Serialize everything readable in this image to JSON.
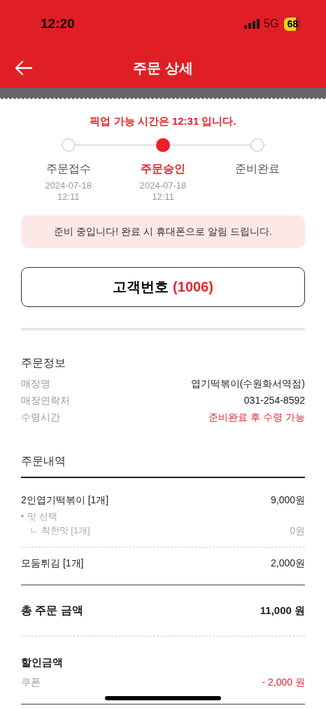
{
  "status_bar": {
    "time": "12:20",
    "network": "5G",
    "battery": "68"
  },
  "header": {
    "title": "주문 상세"
  },
  "pickup_notice": "픽업 가능 시간은 12:31 입니다.",
  "steps": [
    {
      "label": "주문접수",
      "date": "2024-07-18",
      "time": "12:11",
      "selected": false
    },
    {
      "label": "주문승인",
      "date": "2024-07-18",
      "time": "12:11",
      "selected": true
    },
    {
      "label": "준비완료",
      "selected": false
    }
  ],
  "alert": "준비 중입니다! 완료 시 휴대폰으로 알림 드립니다.",
  "customer_number": {
    "label": "고객번호",
    "value": "(1006)"
  },
  "order_info": {
    "title": "주문정보",
    "rows": [
      {
        "label": "매장명",
        "value": "엽기떡볶이(수원화서역점)",
        "emphasis": false
      },
      {
        "label": "매장연락처",
        "value": "031-254-8592",
        "emphasis": false
      },
      {
        "label": "수령시간",
        "value": "준비완료 후 수령 가능",
        "emphasis": true
      }
    ]
  },
  "order_items": {
    "title": "주문내역",
    "items": [
      {
        "name": "2인엽기떡볶이 [1개]",
        "price": "9,000원",
        "options": [
          {
            "label": "맛 선택",
            "choices": [
              {
                "label": "ㄴ 착한맛 [1개]",
                "price": "0원"
              }
            ]
          }
        ]
      },
      {
        "name": "모둠튀김 [1개]",
        "price": "2,000원"
      }
    ]
  },
  "total": {
    "label": "총 주문 금액",
    "value": "11,000 원"
  },
  "discount": {
    "title": "할인금액",
    "rows": [
      {
        "label": "쿠폰",
        "value": "- 2,000 원"
      }
    ]
  }
}
